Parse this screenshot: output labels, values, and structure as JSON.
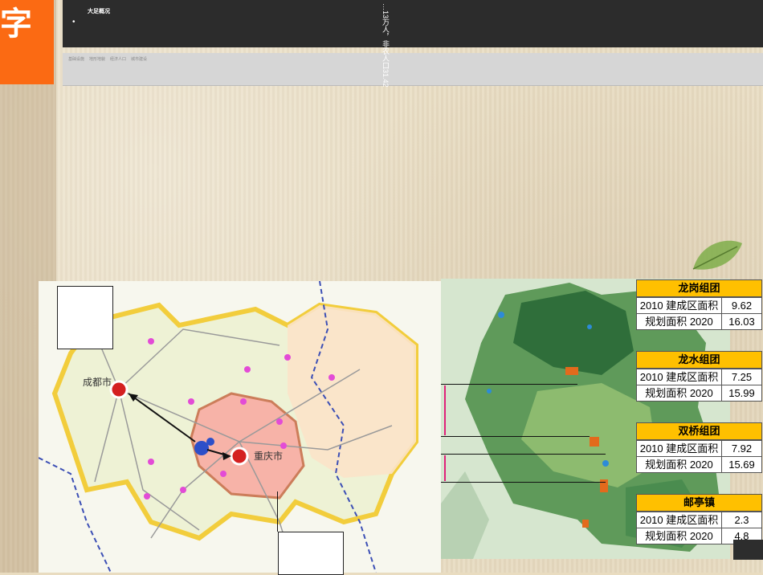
{
  "header": {
    "logo_char": "字",
    "title": "大足概况",
    "bullet": "•",
    "subnav": [
      "基础设施",
      "地形地貌",
      "经济人口",
      "城市建设"
    ],
    "vertical_text": "…13万人，非农人口31.42"
  },
  "map_left": {
    "label_chengdu": "成都市",
    "label_chongqing": "重庆市"
  },
  "tables": [
    {
      "name": "龙岗组团",
      "rows": [
        {
          "label": "2010 建成区面积",
          "value": "9.62"
        },
        {
          "label": "规划面积 2020",
          "value": "16.03"
        }
      ]
    },
    {
      "name": "龙水组团",
      "rows": [
        {
          "label": "2010 建成区面积",
          "value": "7.25"
        },
        {
          "label": "规划面积 2020",
          "value": "15.99"
        }
      ]
    },
    {
      "name": "双桥组团",
      "rows": [
        {
          "label": "2010 建成区面积",
          "value": "7.92"
        },
        {
          "label": "规划面积 2020",
          "value": "15.69"
        }
      ]
    },
    {
      "name": "邮亭镇",
      "rows": [
        {
          "label": "2010 建成区面积",
          "value": "2.3"
        },
        {
          "label": "规划面积 2020",
          "value": "4.8"
        }
      ]
    }
  ],
  "colors": {
    "accent_orange": "#fb6a13",
    "header_dark": "#2c2c2c",
    "table_head": "#ffc000",
    "pink_marker": "#e0217a"
  }
}
